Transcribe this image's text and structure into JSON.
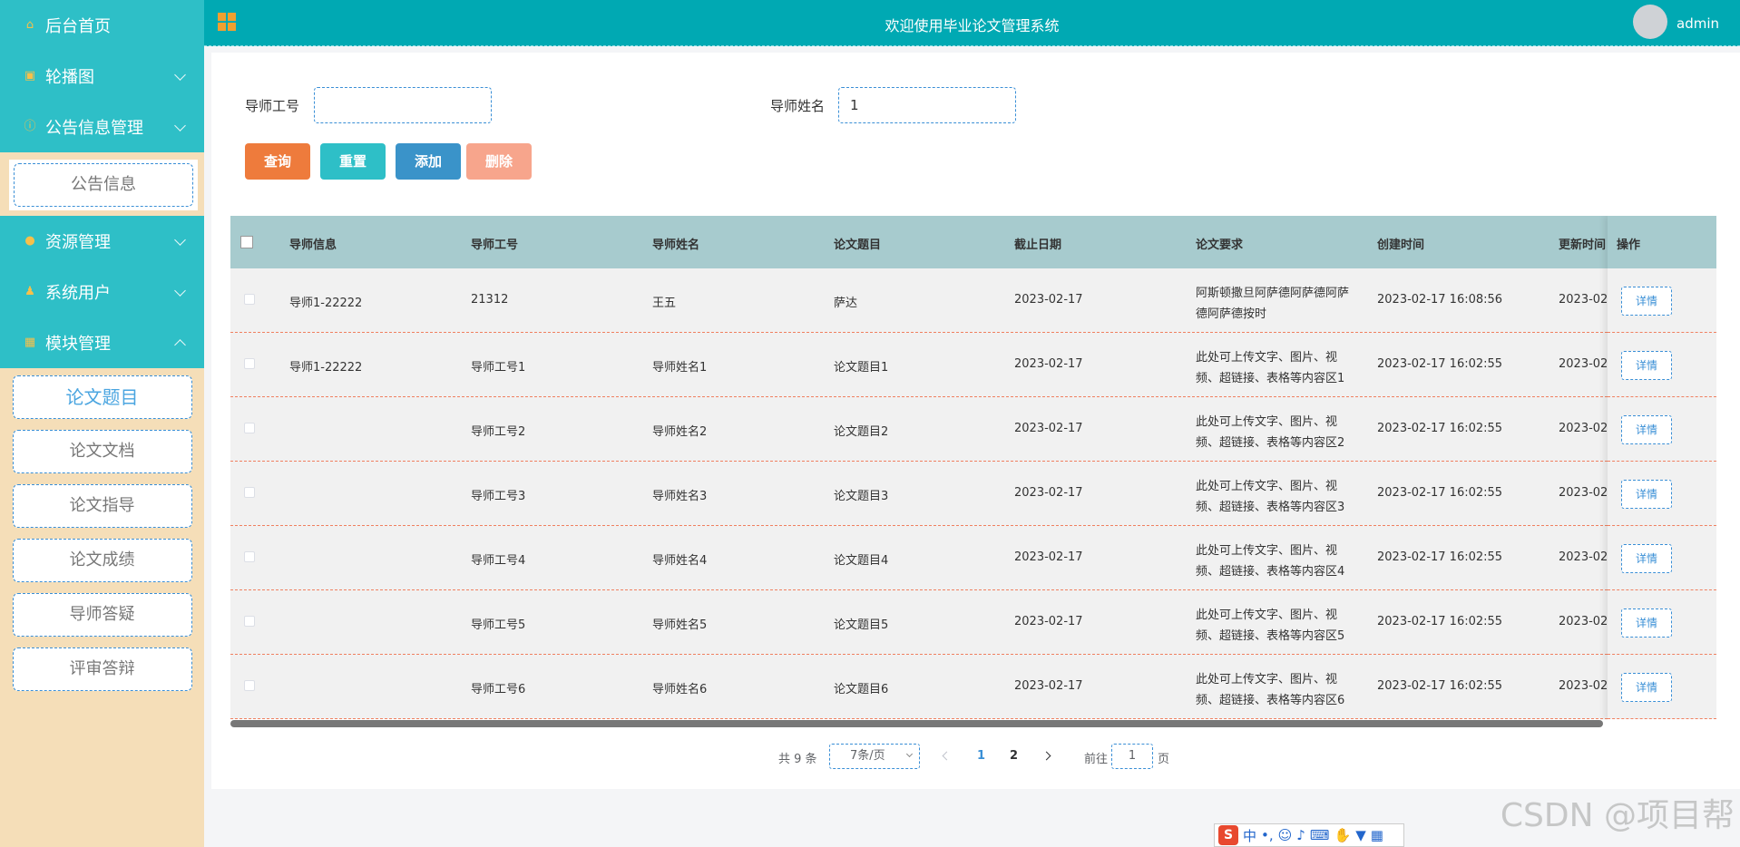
{
  "app": {
    "title": "欢迎使用毕业论文管理系统",
    "user": "admin"
  },
  "sidebar": {
    "home": "后台首页",
    "carousel": "轮播图",
    "notice_mgmt": "公告信息管理",
    "notice_sub": "公告信息",
    "resource_mgmt": "资源管理",
    "system_user": "系统用户",
    "module_mgmt": "模块管理",
    "module_subs": [
      "论文题目",
      "论文文档",
      "论文指导",
      "论文成绩",
      "导师答疑",
      "评审答辩"
    ]
  },
  "search": {
    "teacher_id_label": "导师工号",
    "teacher_id_value": "",
    "teacher_name_label": "导师姓名",
    "teacher_name_value": "1"
  },
  "buttons": {
    "query": "查询",
    "reset": "重置",
    "add": "添加",
    "delete": "删除"
  },
  "table": {
    "columns": [
      "导师信息",
      "导师工号",
      "导师姓名",
      "论文题目",
      "截止日期",
      "论文要求",
      "创建时间",
      "更新时间",
      "操作"
    ],
    "detail_label": "详情",
    "rows": [
      {
        "info": "导师1-22222",
        "tid": "21312",
        "tname": "王五",
        "topic": "萨达",
        "deadline": "2023-02-17",
        "req": "阿斯顿撒旦阿萨德阿萨德阿萨德阿萨德按时",
        "created": "2023-02-17 16:08:56",
        "updated": "2023-02"
      },
      {
        "info": "导师1-22222",
        "tid": "导师工号1",
        "tname": "导师姓名1",
        "topic": "论文题目1",
        "deadline": "2023-02-17",
        "req": "此处可上传文字、图片、视频、超链接、表格等内容区1",
        "created": "2023-02-17 16:02:55",
        "updated": "2023-02"
      },
      {
        "info": "",
        "tid": "导师工号2",
        "tname": "导师姓名2",
        "topic": "论文题目2",
        "deadline": "2023-02-17",
        "req": "此处可上传文字、图片、视频、超链接、表格等内容区2",
        "created": "2023-02-17 16:02:55",
        "updated": "2023-02"
      },
      {
        "info": "",
        "tid": "导师工号3",
        "tname": "导师姓名3",
        "topic": "论文题目3",
        "deadline": "2023-02-17",
        "req": "此处可上传文字、图片、视频、超链接、表格等内容区3",
        "created": "2023-02-17 16:02:55",
        "updated": "2023-02"
      },
      {
        "info": "",
        "tid": "导师工号4",
        "tname": "导师姓名4",
        "topic": "论文题目4",
        "deadline": "2023-02-17",
        "req": "此处可上传文字、图片、视频、超链接、表格等内容区4",
        "created": "2023-02-17 16:02:55",
        "updated": "2023-02"
      },
      {
        "info": "",
        "tid": "导师工号5",
        "tname": "导师姓名5",
        "topic": "论文题目5",
        "deadline": "2023-02-17",
        "req": "此处可上传文字、图片、视频、超链接、表格等内容区5",
        "created": "2023-02-17 16:02:55",
        "updated": "2023-02"
      },
      {
        "info": "",
        "tid": "导师工号6",
        "tname": "导师姓名6",
        "topic": "论文题目6",
        "deadline": "2023-02-17",
        "req": "此处可上传文字、图片、视频、超链接、表格等内容区6",
        "created": "2023-02-17 16:02:55",
        "updated": "2023-02"
      }
    ]
  },
  "pagination": {
    "total": "共 9 条",
    "page_size": "7条/页",
    "pages": [
      "1",
      "2"
    ],
    "goto_label": "前往",
    "goto_value": "1",
    "page_unit": "页"
  },
  "watermark": "CSDN @项目帮",
  "ime": {
    "logo": "S",
    "mode": "中"
  },
  "colors": {
    "header": "#00a9b3",
    "sidebar_menu": "#2ebfc7",
    "sidebar_bg": "#f5deb8",
    "query": "#ee7b3c",
    "reset": "#2ebfc7",
    "add": "#3a93c9",
    "delete": "#f7a58c"
  }
}
